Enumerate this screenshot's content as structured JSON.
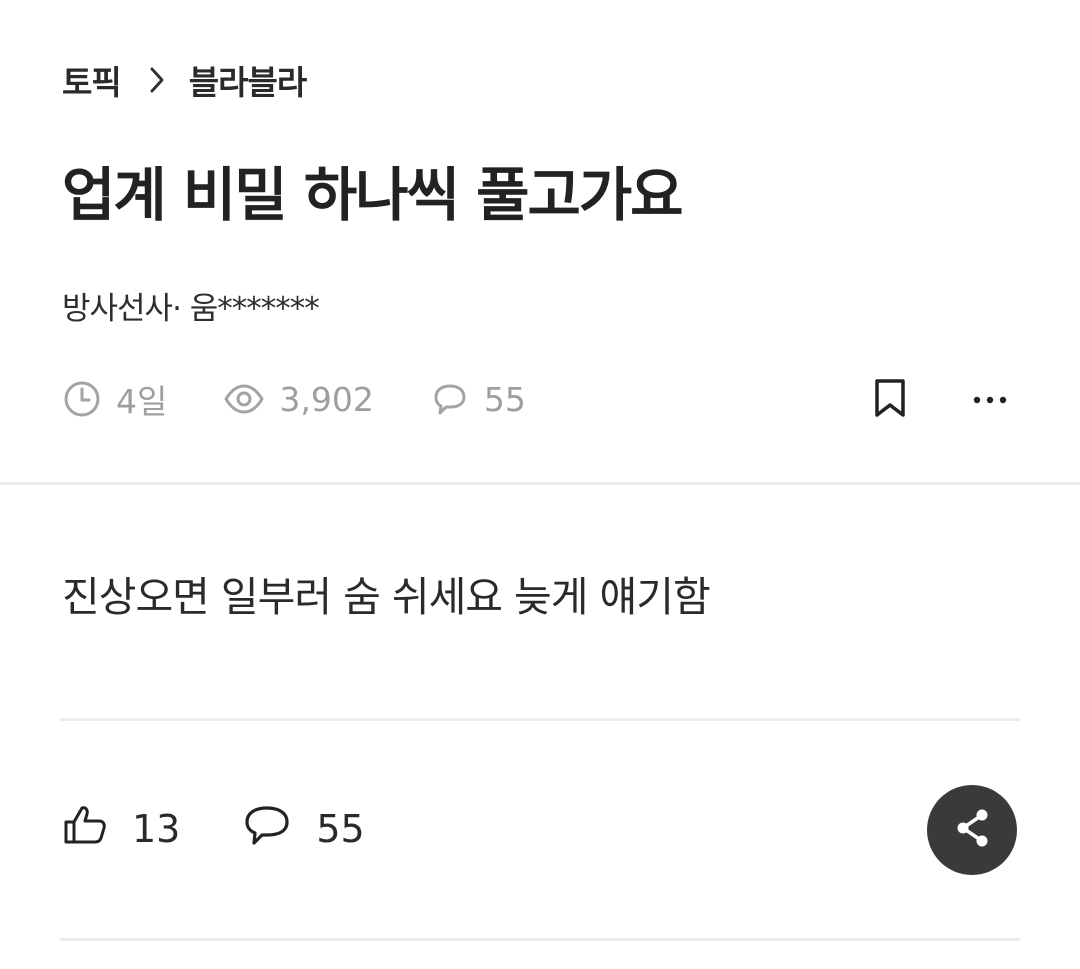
{
  "breadcrumb": {
    "topic": "토픽",
    "board": "블라블라"
  },
  "post": {
    "title": "업계 비밀 하나씩 풀고가요",
    "author": "방사선사· 움*******",
    "body": "진상오면 일부러 숨 쉬세요 늦게 얘기함"
  },
  "stats": {
    "time": "4일",
    "views": "3,902",
    "comments": "55"
  },
  "actions": {
    "likes": "13",
    "comments": "55"
  },
  "icons": {
    "separator": "chevron-right-icon",
    "time": "clock-icon",
    "views": "eye-icon",
    "comments": "speech-bubble-icon",
    "bookmark": "bookmark-icon",
    "more": "more-icon",
    "like": "thumbs-up-icon",
    "share": "share-icon"
  },
  "colors": {
    "muted": "#9e9e9e",
    "text": "#222222",
    "share_button_bg": "#3a3a3d",
    "divider": "#ececec"
  }
}
